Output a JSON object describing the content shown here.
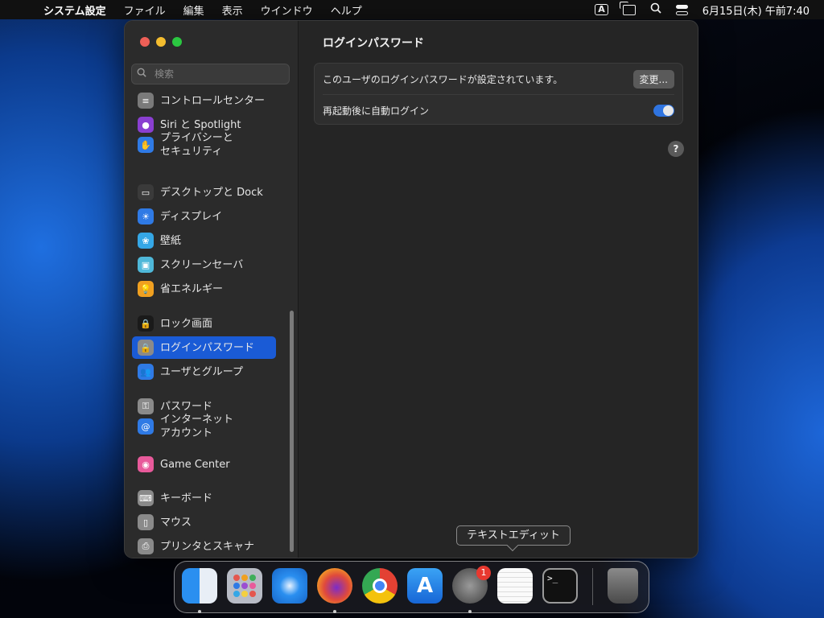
{
  "menubar": {
    "apple": "",
    "items": [
      "システム設定",
      "ファイル",
      "編集",
      "表示",
      "ウインドウ",
      "ヘルプ"
    ],
    "input_indicator": "A",
    "datetime": "6月15日(木) 午前7:40"
  },
  "window": {
    "search_placeholder": "検索",
    "sidebar": [
      {
        "label": "コントロールセンター",
        "icon": "control-center-icon",
        "color": "#7a7a7a"
      },
      {
        "label": "Siri と Spotlight",
        "icon": "siri-icon",
        "color": "#8a3fd1"
      },
      {
        "label": "プライバシーと\nセキュリティ",
        "icon": "hand-icon",
        "color": "#2f7ae5"
      },
      {
        "label": "デスクトップと Dock",
        "icon": "desktop-dock-icon",
        "color": "#3a3a3a"
      },
      {
        "label": "ディスプレイ",
        "icon": "display-icon",
        "color": "#2f7ae5"
      },
      {
        "label": "壁紙",
        "icon": "wallpaper-icon",
        "color": "#35a7e6"
      },
      {
        "label": "スクリーンセーバ",
        "icon": "screensaver-icon",
        "color": "#4fb8d9"
      },
      {
        "label": "省エネルギー",
        "icon": "lightbulb-icon",
        "color": "#f0a020"
      },
      {
        "label": "ロック画面",
        "icon": "lock-screen-icon",
        "color": "#1a1a1a"
      },
      {
        "label": "ログインパスワード",
        "icon": "lock-icon",
        "color": "#8a8a8a"
      },
      {
        "label": "ユーザとグループ",
        "icon": "users-icon",
        "color": "#2f7ae5"
      },
      {
        "label": "パスワード",
        "icon": "key-icon",
        "color": "#8a8a8a"
      },
      {
        "label": "インターネット\nアカウント",
        "icon": "at-icon",
        "color": "#2f7ae5"
      },
      {
        "label": "Game Center",
        "icon": "game-center-icon",
        "color": "#e85a9b"
      },
      {
        "label": "キーボード",
        "icon": "keyboard-icon",
        "color": "#8a8a8a"
      },
      {
        "label": "マウス",
        "icon": "mouse-icon",
        "color": "#8a8a8a"
      },
      {
        "label": "プリンタとスキャナ",
        "icon": "printer-icon",
        "color": "#8a8a8a"
      }
    ],
    "selected": "ログインパスワード",
    "main": {
      "title": "ログインパスワード",
      "password_text": "このユーザのログインパスワードが設定されています。",
      "change_button": "変更...",
      "autologin_text": "再起動後に自動ログイン",
      "autologin_on": true,
      "help": "?"
    }
  },
  "tooltip": "テキストエディット",
  "dock": {
    "apps": [
      {
        "name": "finder-icon",
        "running": true
      },
      {
        "name": "launchpad-icon",
        "running": false
      },
      {
        "name": "safari-icon",
        "running": false
      },
      {
        "name": "firefox-icon",
        "running": true
      },
      {
        "name": "chrome-icon",
        "running": false
      },
      {
        "name": "app-store-icon",
        "running": false
      },
      {
        "name": "system-settings-icon",
        "running": true,
        "badge": "1"
      },
      {
        "name": "textedit-icon",
        "running": false
      },
      {
        "name": "terminal-icon",
        "running": false
      },
      {
        "name": "trash-icon",
        "running": false
      }
    ]
  }
}
